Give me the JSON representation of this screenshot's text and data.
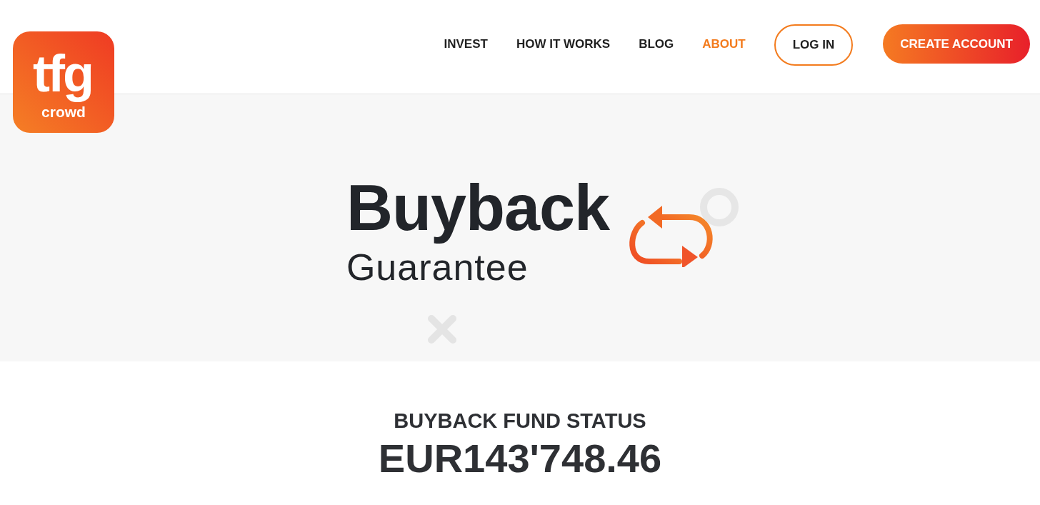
{
  "logo": {
    "mark": "tfg",
    "sub": "crowd"
  },
  "nav": [
    {
      "label": "INVEST",
      "selected": false
    },
    {
      "label": "HOW IT WORKS",
      "selected": false
    },
    {
      "label": "BLOG",
      "selected": false
    },
    {
      "label": "ABOUT",
      "selected": true
    }
  ],
  "buttons": [
    {
      "label": "LOG IN",
      "kind": "outline"
    },
    {
      "label": "CREATE ACCOUNT",
      "kind": "filled"
    }
  ],
  "hero": {
    "title": "Buyback",
    "subtitle": "Guarantee"
  },
  "fund": {
    "heading": "BUYBACK FUND STATUS",
    "amount": "EUR143'748.46"
  }
}
